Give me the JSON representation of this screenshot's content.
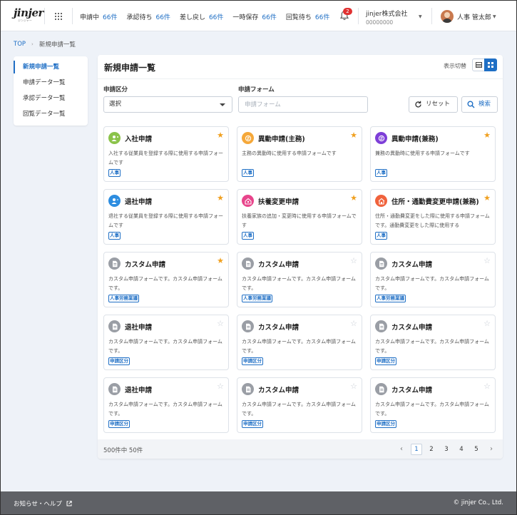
{
  "header": {
    "logo_text": "jinjer",
    "logo_sub": "ジンジャー",
    "status_items": [
      {
        "label": "申請中",
        "count": "66件"
      },
      {
        "label": "承認待ち",
        "count": "66件"
      },
      {
        "label": "差し戻し",
        "count": "66件"
      },
      {
        "label": "一時保存",
        "count": "66件"
      },
      {
        "label": "回覧待ち",
        "count": "66件"
      }
    ],
    "notification_count": "2",
    "company_name": "jinjer株式会社",
    "company_id": "00000000",
    "user_name": "人事 管太郎"
  },
  "breadcrumb": {
    "home": "TOP",
    "current": "新規申請一覧"
  },
  "sidebar": {
    "items": [
      {
        "label": "新規申請一覧"
      },
      {
        "label": "申請データ一覧"
      },
      {
        "label": "承認データ一覧"
      },
      {
        "label": "回覧データ一覧"
      }
    ]
  },
  "main": {
    "title": "新規申請一覧",
    "view_toggle_label": "表示切替",
    "filters": {
      "category_label": "申請区分",
      "category_value": "選択",
      "form_label": "申請フォーム",
      "form_placeholder": "申請フォーム"
    },
    "reset_label": "リセット",
    "search_label": "検索",
    "cards": [
      {
        "title": "入社申請",
        "desc": "入社する従業員を登録する際に使用する申請フォームです",
        "tag": "人事",
        "starred": true,
        "icon_color": "#8bc34a",
        "icon": "user-plus-icon"
      },
      {
        "title": "異動申請(主務)",
        "desc": "主務の異動時に使用する申請フォームです",
        "tag": "人事",
        "starred": true,
        "icon_color": "#f5a83a",
        "icon": "transfer-icon"
      },
      {
        "title": "異動申請(兼務)",
        "desc": "兼務の異動時に使用する申請フォームです",
        "tag": "人事",
        "starred": true,
        "icon_color": "#7e3fd8",
        "icon": "transfer-icon"
      },
      {
        "title": "退社申請",
        "desc": "退社する従業員を登録する際に使用する申請フォームです",
        "tag": "人事",
        "starred": true,
        "icon_color": "#2d8de0",
        "icon": "user-minus-icon"
      },
      {
        "title": "扶養変更申請",
        "desc": "扶養家族の追加・変更時に使用する申請フォームです",
        "tag": "人事",
        "starred": true,
        "icon_color": "#e8458b",
        "icon": "family-icon"
      },
      {
        "title": "住所・通勤費変更申請(兼務)",
        "desc": "住所・通勤費変更をした際に使用する申請フォームです。通勤費変更をした際に使用する",
        "tag": "人事",
        "starred": true,
        "icon_color": "#f0623c",
        "icon": "house-icon"
      },
      {
        "title": "カスタム申請",
        "desc": "カスタム申請フォームです。カスタム申請フォームです。",
        "tag": "人事労務業議",
        "starred": true,
        "icon_color": "#9a9ea5",
        "icon": "document-icon"
      },
      {
        "title": "カスタム申請",
        "desc": "カスタム申請フォームです。カスタム申請フォームです。",
        "tag": "人事労務業議",
        "starred": false,
        "icon_color": "#9a9ea5",
        "icon": "document-icon"
      },
      {
        "title": "カスタム申請",
        "desc": "カスタム申請フォームです。カスタム申請フォームです。",
        "tag": "人事労務業議",
        "starred": false,
        "icon_color": "#9a9ea5",
        "icon": "document-icon"
      },
      {
        "title": "退社申請",
        "desc": "カスタム申請フォームです。カスタム申請フォームです。",
        "tag": "申請区分",
        "starred": false,
        "icon_color": "#9a9ea5",
        "icon": "document-icon"
      },
      {
        "title": "カスタム申請",
        "desc": "カスタム申請フォームです。カスタム申請フォームです。",
        "tag": "申請区分",
        "starred": false,
        "icon_color": "#9a9ea5",
        "icon": "document-icon"
      },
      {
        "title": "カスタム申請",
        "desc": "カスタム申請フォームです。カスタム申請フォームです。",
        "tag": "申請区分",
        "starred": false,
        "icon_color": "#9a9ea5",
        "icon": "document-icon"
      },
      {
        "title": "退社申請",
        "desc": "カスタム申請フォームです。カスタム申請フォームです。",
        "tag": "申請区分",
        "starred": false,
        "icon_color": "#9a9ea5",
        "icon": "document-icon"
      },
      {
        "title": "カスタム申請",
        "desc": "カスタム申請フォームです。カスタム申請フォームです。",
        "tag": "申請区分",
        "starred": false,
        "icon_color": "#9a9ea5",
        "icon": "document-icon"
      },
      {
        "title": "カスタム申請",
        "desc": "カスタム申請フォームです。カスタム申請フォームです。",
        "tag": "申請区分",
        "starred": false,
        "icon_color": "#9a9ea5",
        "icon": "document-icon"
      }
    ],
    "total": "500件中 50件",
    "pagination": {
      "pages": [
        "1",
        "2",
        "3",
        "4",
        "5"
      ],
      "current": "1",
      "prev": "‹",
      "next": "›"
    }
  },
  "footer": {
    "help": "お知らせ・ヘルプ",
    "copyright": "© jinjer Co., Ltd."
  },
  "colors": {
    "accent": "#1f6fc5",
    "star": "#f0a020",
    "badge": "#e03131",
    "footer_bg": "#5f6166"
  }
}
